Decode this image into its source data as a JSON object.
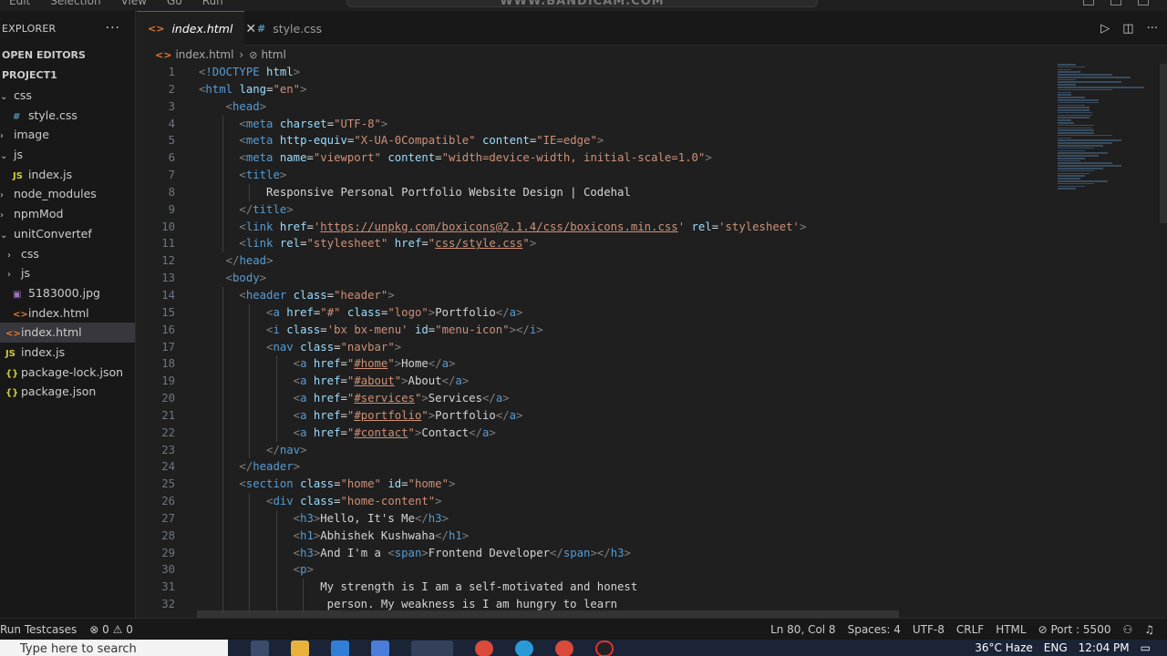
{
  "titlebar": {
    "menu": [
      "Edit",
      "Selection",
      "View",
      "Go",
      "Run"
    ],
    "command_center": "WWW.BANDICAM.COM"
  },
  "sidebar": {
    "header": "EXPLORER",
    "more": "···",
    "open_editors": "OPEN EDITORS",
    "project": "PROJECT1",
    "items": [
      {
        "label": "css",
        "type": "folder",
        "indent": 0
      },
      {
        "label": "style.css",
        "type": "css",
        "indent": 1
      },
      {
        "label": "image",
        "type": "folder-closed",
        "indent": 0
      },
      {
        "label": "js",
        "type": "folder",
        "indent": 0
      },
      {
        "label": "index.js",
        "type": "js",
        "indent": 1
      },
      {
        "label": "node_modules",
        "type": "folder-closed",
        "indent": 0
      },
      {
        "label": "npmMod",
        "type": "folder-closed",
        "indent": 0
      },
      {
        "label": "unitConvertef",
        "type": "folder",
        "indent": 0
      },
      {
        "label": "css",
        "type": "folder-closed",
        "indent": 1
      },
      {
        "label": "js",
        "type": "folder-closed",
        "indent": 1
      },
      {
        "label": "5183000.jpg",
        "type": "img",
        "indent": 1
      },
      {
        "label": "index.html",
        "type": "html",
        "indent": 1
      },
      {
        "label": "index.html",
        "type": "html",
        "indent": 0,
        "active": true
      },
      {
        "label": "index.js",
        "type": "js",
        "indent": 0
      },
      {
        "label": "package-lock.json",
        "type": "json",
        "indent": 0
      },
      {
        "label": "package.json",
        "type": "json",
        "indent": 0
      }
    ]
  },
  "tabs": [
    {
      "label": "index.html",
      "icon": "<>",
      "active": true
    },
    {
      "label": "style.css",
      "icon": "#",
      "active": false
    }
  ],
  "breadcrumb": {
    "file": "index.html",
    "symbol": "html"
  },
  "editor": {
    "lines": [
      "<!DOCTYPE html>",
      "<html lang=\"en\">",
      "    <head>",
      "      <meta charset=\"UTF-8\">",
      "      <meta http-equiv=\"X-UA-0Compatible\" content=\"IE=edge\">",
      "      <meta name=\"viewport\" content=\"width=device-width, initial-scale=1.0\">",
      "      <title>",
      "          Responsive Personal Portfolio Website Design | Codehal",
      "      </title>",
      "      <link href='https://unpkg.com/boxicons@2.1.4/css/boxicons.min.css' rel='stylesheet'>",
      "      <link rel=\"stylesheet\" href=\"css/style.css\">",
      "    </head>",
      "    <body>",
      "      <header class=\"header\">",
      "          <a href=\"#\" class=\"logo\">Portfolio</a>",
      "          <i class='bx bx-menu' id=\"menu-icon\"></i>",
      "          <nav class=\"navbar\">",
      "              <a href=\"#home\">Home</a>",
      "              <a href=\"#about\">About</a>",
      "              <a href=\"#services\">Services</a>",
      "              <a href=\"#portfolio\">Portfolio</a>",
      "              <a href=\"#contact\">Contact</a>",
      "          </nav>",
      "      </header>",
      "      <section class=\"home\" id=\"home\">",
      "          <div class=\"home-content\">",
      "              <h3>Hello, It's Me</h3>",
      "              <h1>Abhishek Kushwaha</h1>",
      "              <h3>And I'm a <span>Frontend Developer</span></h3>",
      "              <p>",
      "                  My strength is I am a self-motivated and honest",
      "                   person. My weakness is I am hungry to learn"
    ]
  },
  "statusbar": {
    "left": [
      "Run Testcases",
      "⊗ 0 ⚠ 0"
    ],
    "right": [
      "Ln 80, Col 8",
      "Spaces: 4",
      "UTF-8",
      "CRLF",
      "HTML",
      "⊘ Port : 5500"
    ]
  },
  "taskbar": {
    "search": "Type here to search",
    "weather": "36°C  Haze",
    "lang": "ENG",
    "time": "12:04 PM"
  },
  "colors": {
    "accent": "#0078d4",
    "tag": "#569cd6",
    "attr": "#9cdcfe",
    "string": "#ce9178"
  }
}
